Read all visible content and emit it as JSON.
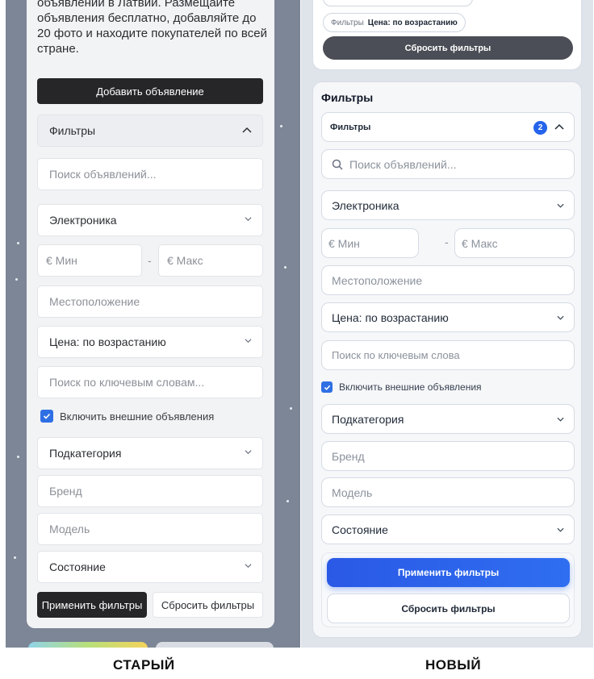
{
  "captions": {
    "old": "СТАРЫЙ",
    "new": "НОВЫЙ"
  },
  "old": {
    "intro": "объявлений в Латвии. Размещайте объявления бесплатно, добавляйте до 20 фото и находите покупателей по всей стране.",
    "add_button": "Добавить объявление",
    "filters_title": "Фильтры",
    "search_placeholder": "Поиск объявлений...",
    "category": "Электроника",
    "price_min_placeholder": "€ Мин",
    "price_max_placeholder": "€ Макс",
    "separator": "-",
    "location_placeholder": "Местоположение",
    "sort": "Цена: по возрастанию",
    "keywords_placeholder": "Поиск по ключевым словам...",
    "external_label": "Включить внешние объявления",
    "subcategory": "Подкатегория",
    "brand_placeholder": "Бренд",
    "model_placeholder": "Модель",
    "condition": "Состояние",
    "apply_button": "Применить фильтры",
    "reset_button": "Сбросить фильтры"
  },
  "new": {
    "chip_key": "Фильтры",
    "chip_value": "Цена: по возрастанию",
    "reset_top_button": "Сбросить фильтры",
    "panel_title": "Фильтры",
    "filters_header": "Фильтры",
    "badge_count": "2",
    "search_placeholder": "Поиск объявлений...",
    "category": "Электроника",
    "price_min_placeholder": "€ Мин",
    "price_max_placeholder": "€ Макс",
    "separator": "-",
    "location_placeholder": "Местоположение",
    "sort": "Цена: по возрастанию",
    "keywords_placeholder": "Поиск по ключевым слова",
    "external_label": "Включить внешние объявления",
    "subcategory": "Подкатегория",
    "brand_placeholder": "Бренд",
    "model_placeholder": "Модель",
    "condition": "Состояние",
    "apply_button": "Применить фильтры",
    "reset_button": "Сбросить фильтры"
  },
  "colors": {
    "accent": "#2563eb",
    "dark_button": "#262628",
    "old_background": "#7c8696"
  }
}
